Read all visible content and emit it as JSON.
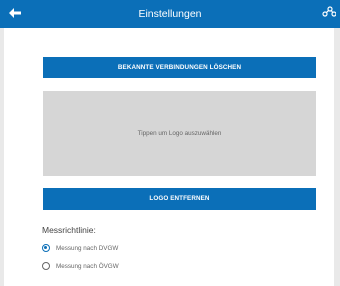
{
  "header": {
    "title": "Einstellungen",
    "back_icon": "back-arrow-icon",
    "share_icon": "share-icon",
    "color": "#0b6fb8"
  },
  "buttons": {
    "clear_connections": "BEKANNTE VERBINDUNGEN LÖSCHEN",
    "remove_logo": "LOGO ENTFERNEN"
  },
  "logo": {
    "placeholder": "Tippen um Logo auszuwählen"
  },
  "measurement": {
    "label": "Messrichtlinie:",
    "options": [
      {
        "label": "Messung nach DVGW",
        "selected": true
      },
      {
        "label": "Messung nach ÖVGW",
        "selected": false
      }
    ]
  }
}
